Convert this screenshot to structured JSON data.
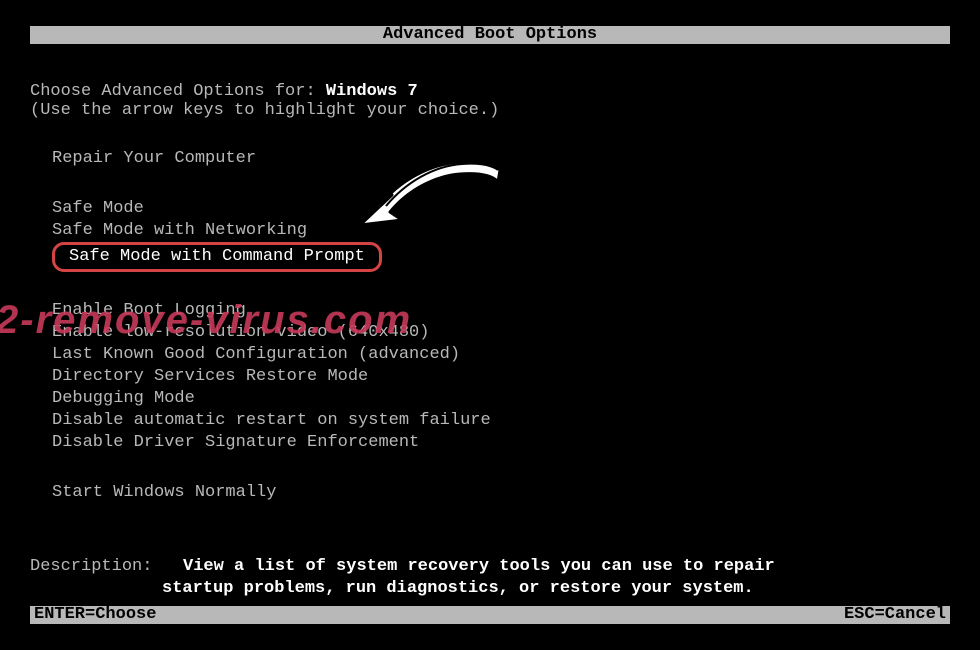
{
  "title": "Advanced Boot Options",
  "choose_prefix": "Choose Advanced Options for: ",
  "os_name": "Windows 7",
  "hint": "(Use the arrow keys to highlight your choice.)",
  "groups": [
    {
      "items": [
        "Repair Your Computer"
      ]
    },
    {
      "items": [
        "Safe Mode",
        "Safe Mode with Networking",
        "Safe Mode with Command Prompt"
      ],
      "highlighted_index": 2
    },
    {
      "items": [
        "Enable Boot Logging",
        "Enable low-resolution video (640x480)",
        "Last Known Good Configuration (advanced)",
        "Directory Services Restore Mode",
        "Debugging Mode",
        "Disable automatic restart on system failure",
        "Disable Driver Signature Enforcement"
      ]
    },
    {
      "items": [
        "Start Windows Normally"
      ]
    }
  ],
  "description_label": "Description:",
  "description_text_line1": "View a list of system recovery tools you can use to repair",
  "description_text_line2": "startup problems, run diagnostics, or restore your system.",
  "footer_left": "ENTER=Choose",
  "footer_right": "ESC=Cancel",
  "watermark": "2-remove-virus.com"
}
